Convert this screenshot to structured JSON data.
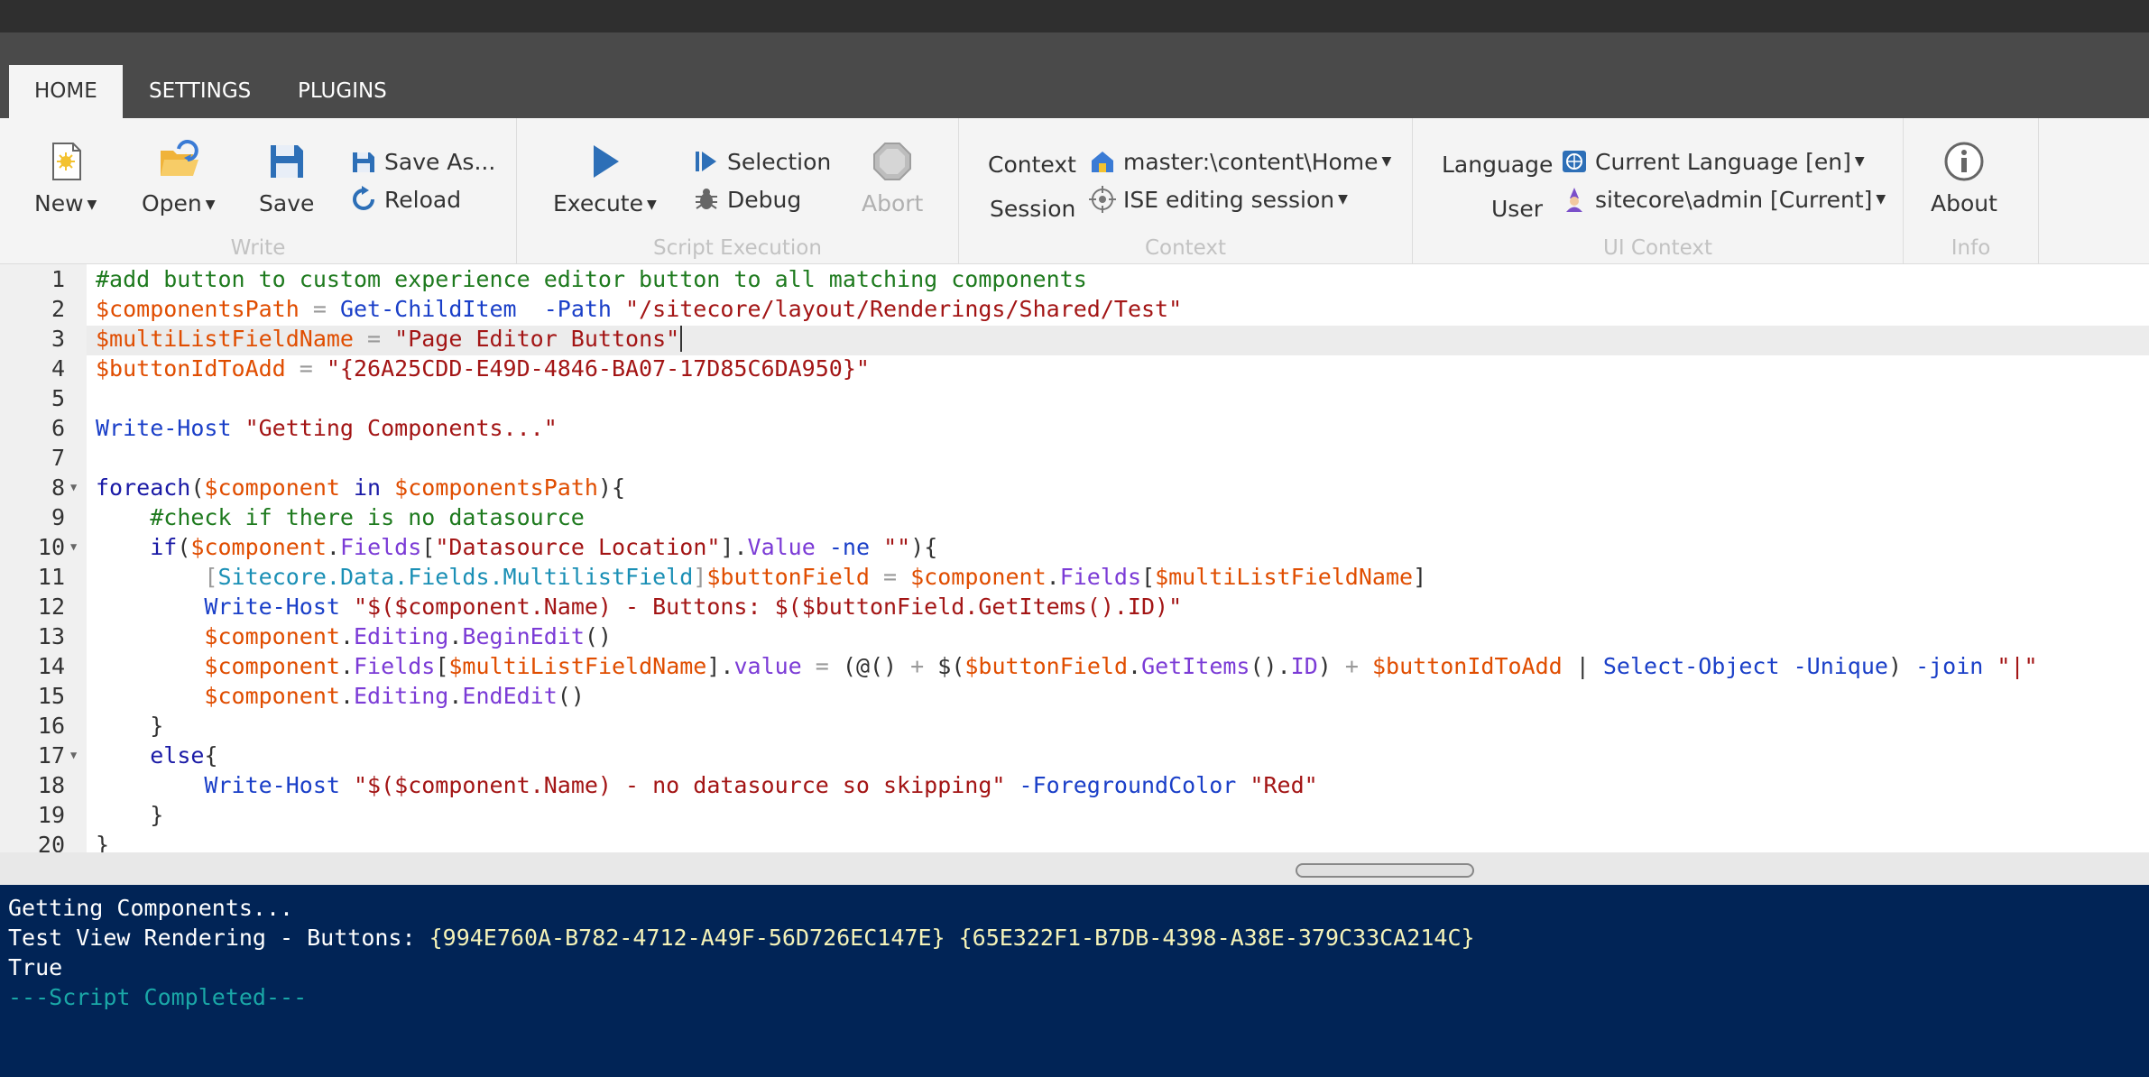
{
  "tabs": [
    {
      "label": "HOME",
      "active": true
    },
    {
      "label": "SETTINGS",
      "active": false
    },
    {
      "label": "PLUGINS",
      "active": false
    }
  ],
  "ribbon": {
    "write": {
      "caption": "Write",
      "new": "New",
      "open": "Open",
      "save": "Save",
      "save_as": "Save As...",
      "reload": "Reload"
    },
    "script_execution": {
      "caption": "Script Execution",
      "execute": "Execute",
      "selection": "Selection",
      "debug": "Debug",
      "abort": "Abort"
    },
    "context": {
      "caption": "Context",
      "context_label": "Context",
      "context_value": "master:\\content\\Home",
      "session_label": "Session",
      "session_value": "ISE editing session"
    },
    "ui_context": {
      "caption": "UI Context",
      "language_label": "Language",
      "language_value": "Current Language [en]",
      "user_label": "User",
      "user_value": "sitecore\\admin [Current]"
    },
    "info": {
      "caption": "Info",
      "about": "About"
    }
  },
  "editor": {
    "line_numbers": [
      "1",
      "2",
      "3",
      "4",
      "5",
      "6",
      "7",
      "8",
      "9",
      "10",
      "11",
      "12",
      "13",
      "14",
      "15",
      "16",
      "17",
      "18",
      "19",
      "20"
    ],
    "lines": [
      [
        [
          "c-cm",
          "#add button to custom experience editor button to all matching components"
        ]
      ],
      [
        [
          "c-var",
          "$componentsPath"
        ],
        [
          "c-op",
          " = "
        ],
        [
          "c-cmd",
          "Get-ChildItem"
        ],
        [
          "",
          "  "
        ],
        [
          "c-par",
          "-Path"
        ],
        [
          "",
          " "
        ],
        [
          "c-str",
          "\"/sitecore/layout/Renderings/Shared/Test\""
        ]
      ],
      [
        [
          "c-var",
          "$multiListFieldName"
        ],
        [
          "c-op",
          " = "
        ],
        [
          "c-str",
          "\"Page Editor Buttons\""
        ]
      ],
      [
        [
          "c-var",
          "$buttonIdToAdd"
        ],
        [
          "c-op",
          " = "
        ],
        [
          "c-str",
          "\"{26A25CDD-E49D-4846-BA07-17D85C6DA950}\""
        ]
      ],
      [],
      [
        [
          "c-cmd",
          "Write-Host"
        ],
        [
          "",
          " "
        ],
        [
          "c-str",
          "\"Getting Components...\""
        ]
      ],
      [],
      [
        [
          "c-kw",
          "foreach"
        ],
        [
          "",
          "("
        ],
        [
          "c-var",
          "$component"
        ],
        [
          "",
          " "
        ],
        [
          "c-kw",
          "in"
        ],
        [
          "",
          " "
        ],
        [
          "c-var",
          "$componentsPath"
        ],
        [
          "",
          "){"
        ]
      ],
      [
        [
          "",
          "    "
        ],
        [
          "c-cm",
          "#check if there is no datasource"
        ]
      ],
      [
        [
          "",
          "    "
        ],
        [
          "c-kw",
          "if"
        ],
        [
          "",
          "("
        ],
        [
          "c-var",
          "$component"
        ],
        [
          "",
          "."
        ],
        [
          "c-prop",
          "Fields"
        ],
        [
          "",
          "["
        ],
        [
          "c-str",
          "\"Datasource Location\""
        ],
        [
          "",
          "]."
        ],
        [
          "c-prop",
          "Value"
        ],
        [
          "",
          " "
        ],
        [
          "c-par",
          "-ne"
        ],
        [
          "",
          " "
        ],
        [
          "c-str",
          "\"\""
        ],
        [
          "",
          "){"
        ]
      ],
      [
        [
          "",
          "        "
        ],
        [
          "c-op",
          "["
        ],
        [
          "c-type",
          "Sitecore.Data.Fields.MultilistField"
        ],
        [
          "c-op",
          "]"
        ],
        [
          "c-var",
          "$buttonField"
        ],
        [
          "c-op",
          " = "
        ],
        [
          "c-var",
          "$component"
        ],
        [
          "",
          "."
        ],
        [
          "c-prop",
          "Fields"
        ],
        [
          "",
          "["
        ],
        [
          "c-var",
          "$multiListFieldName"
        ],
        [
          "",
          "]"
        ]
      ],
      [
        [
          "",
          "        "
        ],
        [
          "c-cmd",
          "Write-Host"
        ],
        [
          "",
          " "
        ],
        [
          "c-str",
          "\"$($component.Name) - Buttons: $($buttonField.GetItems().ID)\""
        ]
      ],
      [
        [
          "",
          "        "
        ],
        [
          "c-var",
          "$component"
        ],
        [
          "",
          "."
        ],
        [
          "c-prop",
          "Editing"
        ],
        [
          "",
          "."
        ],
        [
          "c-prop",
          "BeginEdit"
        ],
        [
          "",
          "()"
        ]
      ],
      [
        [
          "",
          "        "
        ],
        [
          "c-var",
          "$component"
        ],
        [
          "",
          "."
        ],
        [
          "c-prop",
          "Fields"
        ],
        [
          "",
          "["
        ],
        [
          "c-var",
          "$multiListFieldName"
        ],
        [
          "",
          "]."
        ],
        [
          "c-prop",
          "value"
        ],
        [
          "c-op",
          " = "
        ],
        [
          "",
          "(@() "
        ],
        [
          "c-op",
          "+"
        ],
        [
          "",
          " $("
        ],
        [
          "c-var",
          "$buttonField"
        ],
        [
          "",
          "."
        ],
        [
          "c-prop",
          "GetItems"
        ],
        [
          "",
          "()."
        ],
        [
          "c-prop",
          "ID"
        ],
        [
          "",
          ") "
        ],
        [
          "c-op",
          "+"
        ],
        [
          "",
          " "
        ],
        [
          "c-var",
          "$buttonIdToAdd"
        ],
        [
          "",
          " | "
        ],
        [
          "c-cmd",
          "Select-Object"
        ],
        [
          "",
          " "
        ],
        [
          "c-par",
          "-Unique"
        ],
        [
          "",
          ") "
        ],
        [
          "c-par",
          "-join"
        ],
        [
          "",
          " "
        ],
        [
          "c-str",
          "\"|\""
        ]
      ],
      [
        [
          "",
          "        "
        ],
        [
          "c-var",
          "$component"
        ],
        [
          "",
          "."
        ],
        [
          "c-prop",
          "Editing"
        ],
        [
          "",
          "."
        ],
        [
          "c-prop",
          "EndEdit"
        ],
        [
          "",
          "()"
        ]
      ],
      [
        [
          "",
          "    }"
        ]
      ],
      [
        [
          "",
          "    "
        ],
        [
          "c-kw",
          "else"
        ],
        [
          "",
          "{"
        ]
      ],
      [
        [
          "",
          "        "
        ],
        [
          "c-cmd",
          "Write-Host"
        ],
        [
          "",
          " "
        ],
        [
          "c-str",
          "\"$($component.Name) - no datasource so skipping\""
        ],
        [
          "",
          " "
        ],
        [
          "c-par",
          "-ForegroundColor"
        ],
        [
          "",
          " "
        ],
        [
          "c-str",
          "\"Red\""
        ]
      ],
      [
        [
          "",
          "    }"
        ]
      ],
      [
        [
          "",
          "}"
        ]
      ]
    ]
  },
  "console": {
    "line1": "Getting Components...",
    "line2_prefix": "Test View Rendering - Buttons: ",
    "line2_ids": "{994E760A-B782-4712-A49F-56D726EC147E} {65E322F1-B7DB-4398-A38E-379C33CA214C}",
    "line3": "True",
    "line4": "---Script Completed---"
  }
}
